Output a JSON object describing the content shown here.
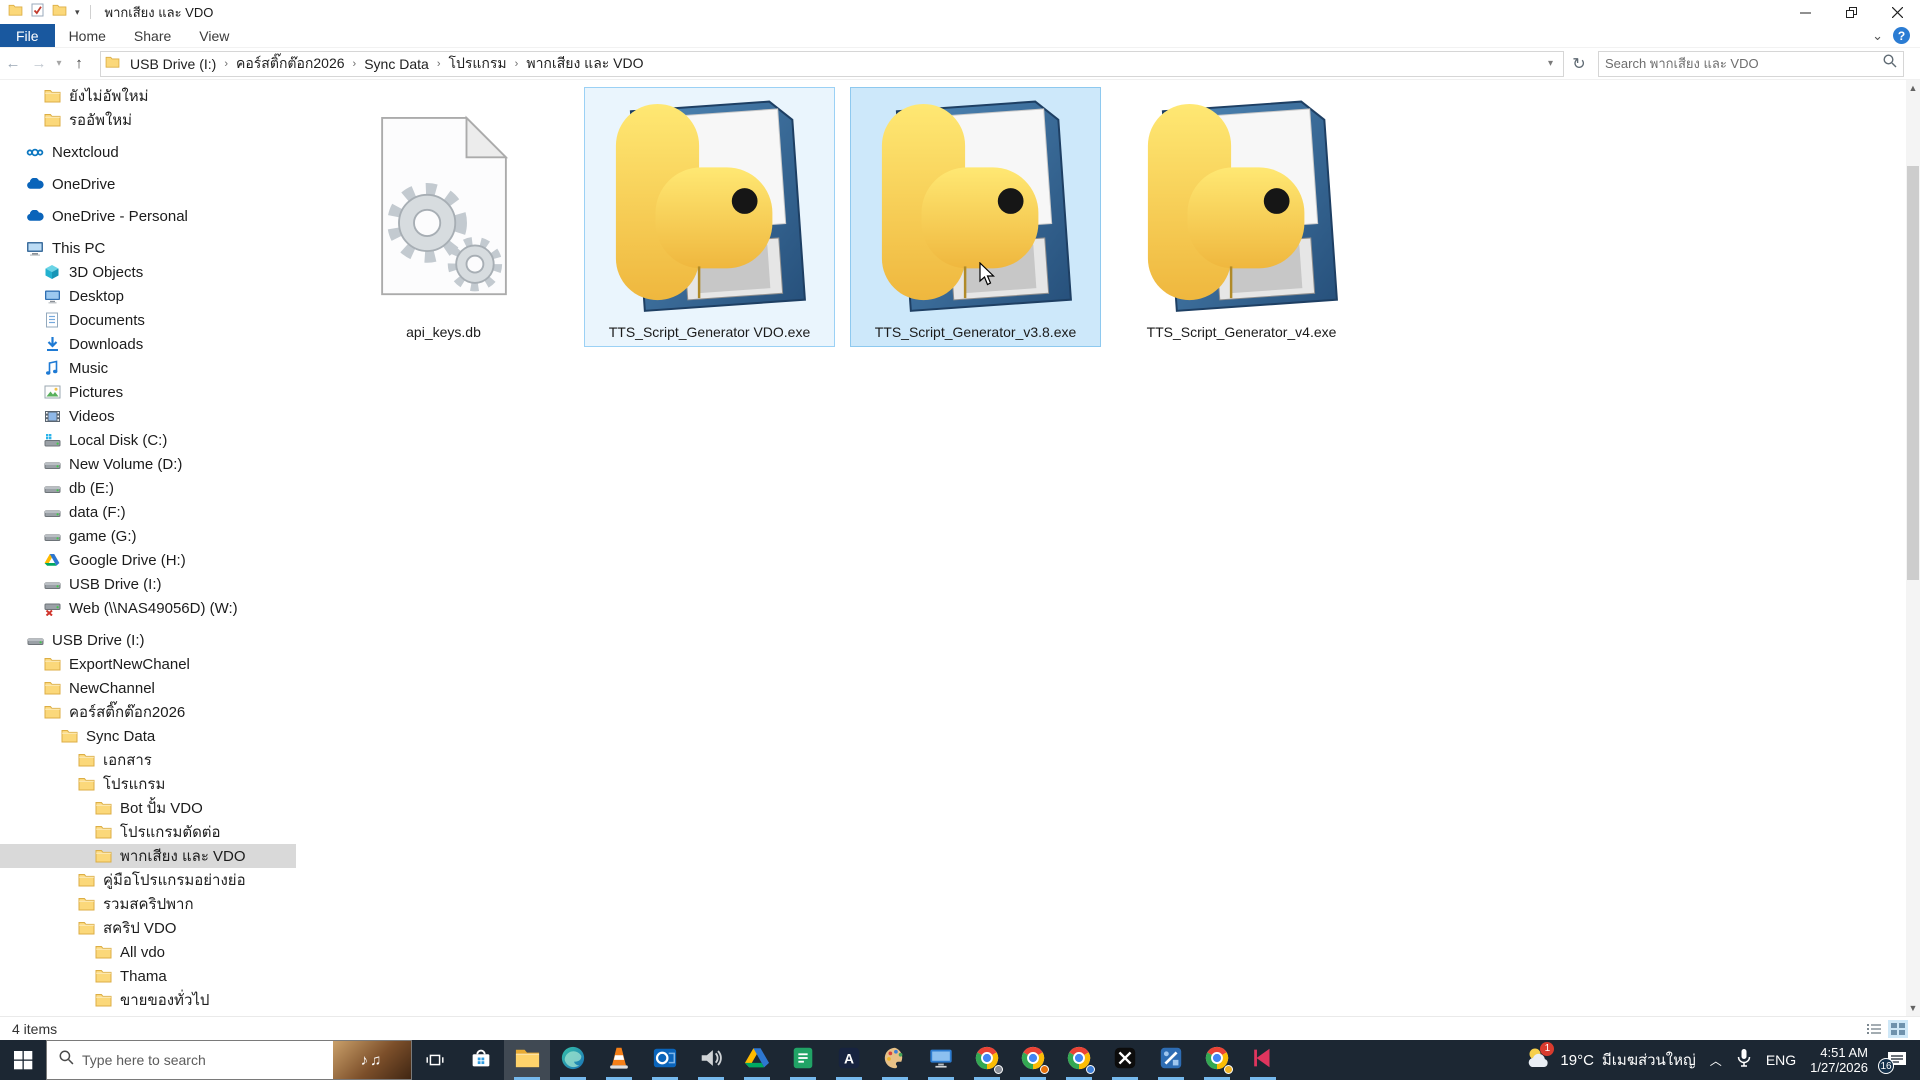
{
  "titlebar": {
    "title": "พากเสียง และ VDO"
  },
  "ribbon": {
    "tabs": [
      {
        "label": "File",
        "active": true
      },
      {
        "label": "Home",
        "active": false
      },
      {
        "label": "Share",
        "active": false
      },
      {
        "label": "View",
        "active": false
      }
    ],
    "help_label": "?"
  },
  "navbar": {
    "breadcrumb": [
      "USB Drive (I:)",
      "คอร์สติ๊กต๊อก2026",
      "Sync Data",
      "โปรแกรม",
      "พากเสียง และ VDO"
    ],
    "search_placeholder": "Search พากเสียง และ VDO"
  },
  "sidebar": {
    "items": [
      {
        "label": "ยังไม่อัพใหม่",
        "icon": "folder",
        "level": 1
      },
      {
        "label": "รออัพใหม่",
        "icon": "folder",
        "level": 1
      },
      {
        "label": "Nextcloud",
        "icon": "nextcloud",
        "level": 0,
        "gap": true
      },
      {
        "label": "OneDrive",
        "icon": "onedrive",
        "level": 0,
        "gap": true
      },
      {
        "label": "OneDrive - Personal",
        "icon": "onedrive",
        "level": 0,
        "gap": true
      },
      {
        "label": "This PC",
        "icon": "thispc",
        "level": 0,
        "gap": true
      },
      {
        "label": "3D Objects",
        "icon": "cube",
        "level": 1
      },
      {
        "label": "Desktop",
        "icon": "desktop",
        "level": 1
      },
      {
        "label": "Documents",
        "icon": "document",
        "level": 1
      },
      {
        "label": "Downloads",
        "icon": "download",
        "level": 1
      },
      {
        "label": "Music",
        "icon": "music",
        "level": 1
      },
      {
        "label": "Pictures",
        "icon": "pictures",
        "level": 1
      },
      {
        "label": "Videos",
        "icon": "videos",
        "level": 1
      },
      {
        "label": "Local Disk (C:)",
        "icon": "drive-windows",
        "level": 1
      },
      {
        "label": "New Volume (D:)",
        "icon": "drive",
        "level": 1
      },
      {
        "label": "db (E:)",
        "icon": "drive",
        "level": 1
      },
      {
        "label": "data (F:)",
        "icon": "drive",
        "level": 1
      },
      {
        "label": "game (G:)",
        "icon": "drive",
        "level": 1
      },
      {
        "label": "Google Drive (H:)",
        "icon": "gdrive",
        "level": 1
      },
      {
        "label": "USB Drive (I:)",
        "icon": "drive",
        "level": 1
      },
      {
        "label": "Web (\\\\NAS49056D) (W:)",
        "icon": "netdrive-x",
        "level": 1
      },
      {
        "label": "USB Drive (I:)",
        "icon": "drive",
        "level": 0,
        "gap": true
      },
      {
        "label": "ExportNewChanel",
        "icon": "folder",
        "level": 1
      },
      {
        "label": "NewChannel",
        "icon": "folder",
        "level": 1
      },
      {
        "label": "คอร์สติ๊กต๊อก2026",
        "icon": "folder",
        "level": 1
      },
      {
        "label": "Sync Data",
        "icon": "folder",
        "level": 2
      },
      {
        "label": "เอกสาร",
        "icon": "folder",
        "level": 3
      },
      {
        "label": "โปรแกรม",
        "icon": "folder",
        "level": 3
      },
      {
        "label": "Bot ปั้ม VDO",
        "icon": "folder",
        "level": 4
      },
      {
        "label": "โปรแกรมตัดต่อ",
        "icon": "folder",
        "level": 4
      },
      {
        "label": "พากเสียง และ VDO",
        "icon": "folder",
        "level": 4,
        "selected": true
      },
      {
        "label": "คู่มือโปรแกรมอย่างย่อ",
        "icon": "folder",
        "level": 3
      },
      {
        "label": "รวมสคริปพาก",
        "icon": "folder",
        "level": 3
      },
      {
        "label": "สคริป VDO",
        "icon": "folder",
        "level": 3
      },
      {
        "label": "All vdo",
        "icon": "folder",
        "level": 4
      },
      {
        "label": "Thama",
        "icon": "folder",
        "level": 4
      },
      {
        "label": "ขายของทั่วไป",
        "icon": "folder",
        "level": 4
      },
      {
        "label": "",
        "icon": "folder",
        "level": 4
      }
    ]
  },
  "files": {
    "items": [
      {
        "name": "api_keys.db",
        "icon": "db-file",
        "state": "normal"
      },
      {
        "name": "TTS_Script_Generator VDO.exe",
        "icon": "python-app",
        "state": "selected"
      },
      {
        "name": "TTS_Script_Generator_v3.8.exe",
        "icon": "python-app",
        "state": "selected-hover"
      },
      {
        "name": "TTS_Script_Generator_v4.exe",
        "icon": "python-app",
        "state": "normal"
      }
    ]
  },
  "statusbar": {
    "items_count": "4 items"
  },
  "taskbar": {
    "search_placeholder": "Type here to search",
    "apps": [
      {
        "icon": "store",
        "running": false,
        "active": false
      },
      {
        "icon": "file-explorer",
        "running": true,
        "active": true
      },
      {
        "icon": "edge",
        "running": true,
        "active": false
      },
      {
        "icon": "vlc",
        "running": true,
        "active": false
      },
      {
        "icon": "outlook",
        "running": true,
        "active": false
      },
      {
        "icon": "audio-app",
        "running": true,
        "active": false
      },
      {
        "icon": "google-drive",
        "running": true,
        "active": false
      },
      {
        "icon": "green-document",
        "running": true,
        "active": false
      },
      {
        "icon": "app-a",
        "running": true,
        "active": false
      },
      {
        "icon": "paint-palette",
        "running": true,
        "active": false
      },
      {
        "icon": "remote-desktop",
        "running": true,
        "active": false
      },
      {
        "icon": "chrome",
        "running": true,
        "active": false,
        "badge": "#8a8f98"
      },
      {
        "icon": "chrome",
        "running": true,
        "active": false,
        "badge": "#e8710a"
      },
      {
        "icon": "chrome",
        "running": true,
        "active": false,
        "badge": "#3f7fd6"
      },
      {
        "icon": "x-app",
        "running": true,
        "active": false
      },
      {
        "icon": "sql-tool",
        "running": true,
        "active": false
      },
      {
        "icon": "chrome",
        "running": true,
        "active": false,
        "badge": "#f0b429"
      },
      {
        "icon": "media-red",
        "running": true,
        "active": false
      }
    ],
    "tray": {
      "weather_badge": "1",
      "temperature": "19°C",
      "weather_text": "มีเมฆส่วนใหญ่",
      "language": "ENG",
      "time": "4:51 AM",
      "date": "1/27/2026",
      "notification_badge": "16"
    }
  },
  "colors": {
    "accent_blue": "#19589f",
    "selection_fill": "#cde8fa",
    "selection_border": "#8ec9ef",
    "sidebar_selected": "#d9d9d9",
    "taskbar_bg": "#1c2733",
    "running_indicator": "#76b9ed"
  }
}
